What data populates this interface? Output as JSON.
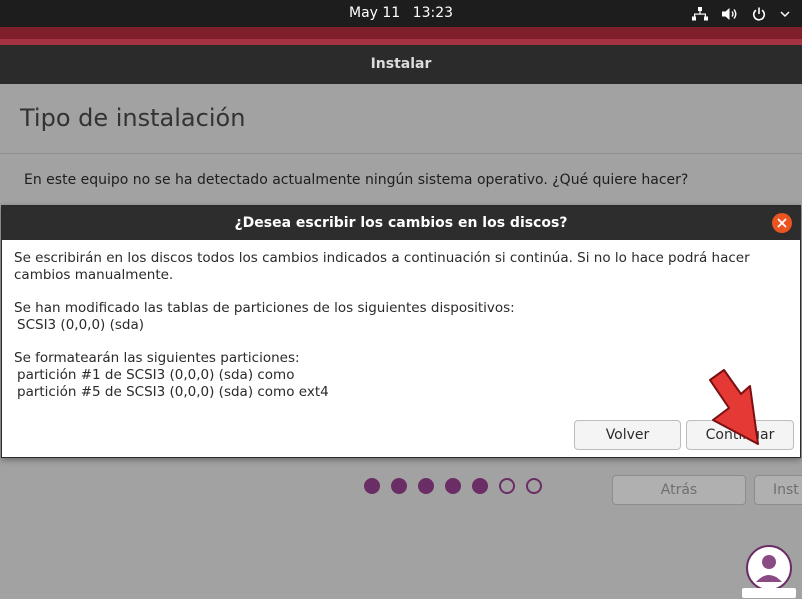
{
  "topbar": {
    "date": "May 11",
    "time": "13:23",
    "tray_icons": [
      "network-icon",
      "volume-icon",
      "power-icon",
      "chevron-down-icon"
    ]
  },
  "window": {
    "title": "Instalar",
    "page_title": "Tipo de instalación",
    "question": "En este equipo no se ha detectado actualmente ningún sistema operativo. ¿Qué quiere hacer?",
    "buttons": {
      "back": "Atrás",
      "install": "Inst"
    },
    "progress": {
      "total_steps": 7,
      "completed_steps": 5
    }
  },
  "dialog": {
    "title": "¿Desea escribir los cambios en los discos?",
    "intro": "Se escribirán en los discos todos los cambios indicados a continuación si continúa. Si no lo hace podrá hacer cambios manualmente.",
    "tables_heading": "Se han modificado las tablas de particiones de los siguientes dispositivos:",
    "devices": [
      "SCSI3 (0,0,0) (sda)"
    ],
    "format_heading": "Se formatearán las siguientes particiones:",
    "partitions": [
      "partición #1 de SCSI3 (0,0,0) (sda) como",
      "partición #5 de SCSI3 (0,0,0) (sda) como ext4"
    ],
    "buttons": {
      "back": "Volver",
      "continue": "Continuar"
    }
  },
  "colors": {
    "accent_orange": "#e95420",
    "dot_purple": "#6a2d65",
    "annotation_arrow": "#e53935"
  }
}
